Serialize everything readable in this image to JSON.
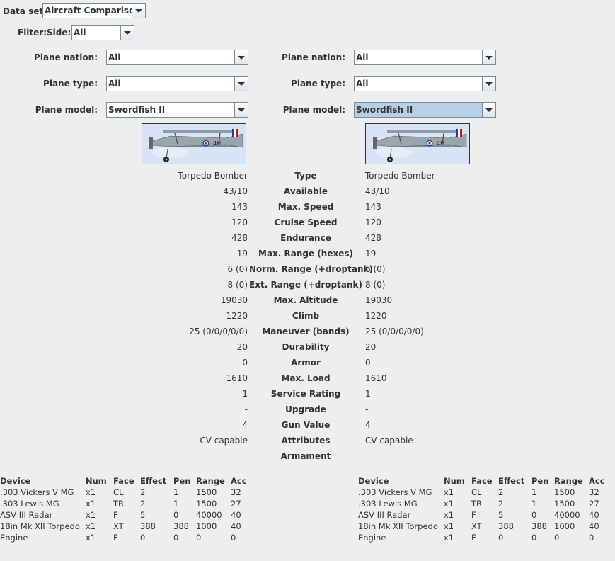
{
  "dataset": {
    "label": "Data set:",
    "value": "Aircraft Comparison"
  },
  "filter": {
    "label": "Filter:",
    "side_label": "Side:",
    "side_value": "All"
  },
  "left": {
    "nation_label": "Plane nation:",
    "nation_value": "All",
    "type_label": "Plane type:",
    "type_value": "All",
    "model_label": "Plane model:",
    "model_value": "Swordfish II"
  },
  "right": {
    "nation_label": "Plane nation:",
    "nation_value": "All",
    "type_label": "Plane type:",
    "type_value": "All",
    "model_label": "Plane model:",
    "model_value": "Swordfish II"
  },
  "comparison": [
    {
      "label": "Type",
      "left": "Torpedo Bomber",
      "right": "Torpedo Bomber"
    },
    {
      "label": "Available",
      "left": "43/10",
      "right": "43/10"
    },
    {
      "label": "Max. Speed",
      "left": "143",
      "right": "143"
    },
    {
      "label": "Cruise Speed",
      "left": "120",
      "right": "120"
    },
    {
      "label": "Endurance",
      "left": "428",
      "right": "428"
    },
    {
      "label": "Max. Range (hexes)",
      "left": "19",
      "right": "19"
    },
    {
      "label": "Norm. Range (+droptank)",
      "left": "6 (0)",
      "right": "6 (0)"
    },
    {
      "label": "Ext. Range (+droptank)",
      "left": "8 (0)",
      "right": "8 (0)"
    },
    {
      "label": "Max. Altitude",
      "left": "19030",
      "right": "19030"
    },
    {
      "label": "Climb",
      "left": "1220",
      "right": "1220"
    },
    {
      "label": "Maneuver (bands)",
      "left": "25 (0/0/0/0/0)",
      "right": "25 (0/0/0/0/0)"
    },
    {
      "label": "Durability",
      "left": "20",
      "right": "20"
    },
    {
      "label": "Armor",
      "left": "0",
      "right": "0"
    },
    {
      "label": "Max. Load",
      "left": "1610",
      "right": "1610"
    },
    {
      "label": "Service Rating",
      "left": "1",
      "right": "1"
    },
    {
      "label": "Upgrade",
      "left": "-",
      "right": "-"
    },
    {
      "label": "Gun Value",
      "left": "4",
      "right": "4"
    },
    {
      "label": "Attributes",
      "left": "CV capable",
      "right": "CV capable"
    },
    {
      "label": "Armament",
      "left": "",
      "right": ""
    }
  ],
  "armament": {
    "headers": [
      "Device",
      "Num",
      "Face",
      "Effect",
      "Pen",
      "Range",
      "Acc"
    ],
    "left_rows": [
      [
        ".303 Vickers V MG",
        "x1",
        "CL",
        "2",
        "1",
        "1500",
        "32"
      ],
      [
        ".303 Lewis MG",
        "x1",
        "TR",
        "2",
        "1",
        "1500",
        "27"
      ],
      [
        "ASV III Radar",
        "x1",
        "F",
        "5",
        "0",
        "40000",
        "40"
      ],
      [
        "18in Mk XII Torpedo",
        "x1",
        "XT",
        "388",
        "388",
        "1000",
        "40"
      ],
      [
        "Engine",
        "x1",
        "F",
        "0",
        "0",
        "0",
        "0"
      ]
    ],
    "right_rows": [
      [
        ".303 Vickers V MG",
        "x1",
        "CL",
        "2",
        "1",
        "1500",
        "32"
      ],
      [
        ".303 Lewis MG",
        "x1",
        "TR",
        "2",
        "1",
        "1500",
        "27"
      ],
      [
        "ASV III Radar",
        "x1",
        "F",
        "5",
        "0",
        "40000",
        "40"
      ],
      [
        "18in Mk XII Torpedo",
        "x1",
        "XT",
        "388",
        "388",
        "1000",
        "40"
      ],
      [
        "Engine",
        "x1",
        "F",
        "0",
        "0",
        "0",
        "0"
      ]
    ]
  },
  "icons": {
    "dropdown": "chevron-down-icon",
    "plane_image": "biplane-icon"
  },
  "colors": {
    "background": "#eeeeee",
    "combo_selected": "#b8cfe5",
    "combo_border": "#7a8a99"
  }
}
